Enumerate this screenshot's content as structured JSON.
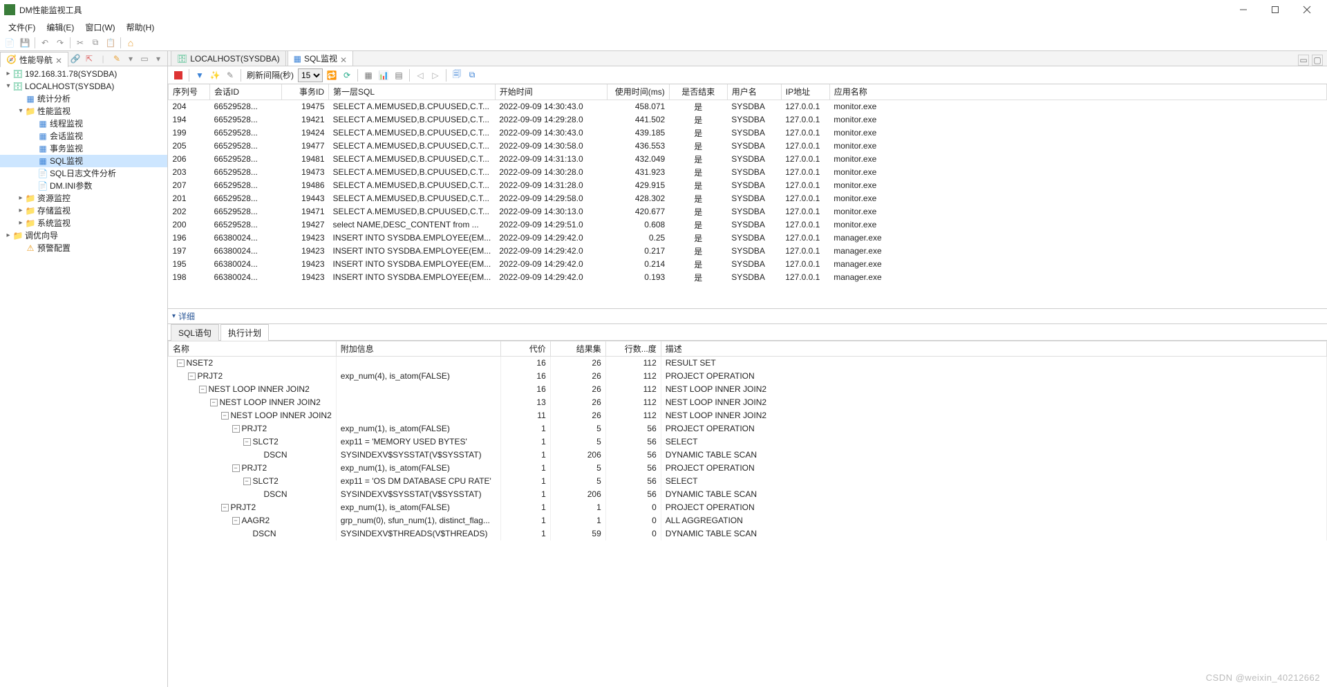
{
  "app": {
    "title": "DM性能监视工具"
  },
  "menu": {
    "file": "文件(F)",
    "edit": "编辑(E)",
    "window": "窗口(W)",
    "help": "帮助(H)"
  },
  "sidebar": {
    "tab_label": "性能导航",
    "tree": [
      {
        "indent": 0,
        "twisty": ">",
        "icon": "db",
        "label": "192.168.31.78(SYSDBA)"
      },
      {
        "indent": 0,
        "twisty": "v",
        "icon": "db",
        "label": "LOCALHOST(SYSDBA)"
      },
      {
        "indent": 1,
        "twisty": "",
        "icon": "grid",
        "label": "统计分析"
      },
      {
        "indent": 1,
        "twisty": "v",
        "icon": "folder",
        "label": "性能监视"
      },
      {
        "indent": 2,
        "twisty": "",
        "icon": "grid",
        "label": "线程监视"
      },
      {
        "indent": 2,
        "twisty": "",
        "icon": "grid",
        "label": "会话监视"
      },
      {
        "indent": 2,
        "twisty": "",
        "icon": "grid",
        "label": "事务监视"
      },
      {
        "indent": 2,
        "twisty": "",
        "icon": "sql",
        "label": "SQL监视",
        "selected": true
      },
      {
        "indent": 2,
        "twisty": "",
        "icon": "log",
        "label": "SQL日志文件分析"
      },
      {
        "indent": 2,
        "twisty": "",
        "icon": "ini",
        "label": "DM.INI参数"
      },
      {
        "indent": 1,
        "twisty": ">",
        "icon": "folder",
        "label": "资源监控"
      },
      {
        "indent": 1,
        "twisty": ">",
        "icon": "folder",
        "label": "存储监视"
      },
      {
        "indent": 1,
        "twisty": ">",
        "icon": "folder",
        "label": "系统监视"
      },
      {
        "indent": 0,
        "twisty": ">",
        "icon": "folder",
        "label": "调优向导"
      },
      {
        "indent": 1,
        "twisty": "",
        "icon": "alert",
        "label": "预警配置"
      }
    ]
  },
  "tabs": {
    "host": "LOCALHOST(SYSDBA)",
    "sql": "SQL监视"
  },
  "toolbar": {
    "refresh_label": "刷新间隔(秒)",
    "refresh_value": "15"
  },
  "grid": {
    "columns": [
      "序列号",
      "会话ID",
      "事务ID",
      "第一层SQL",
      "开始时间",
      "使用时间(ms)",
      "是否结束",
      "用户名",
      "IP地址",
      "应用名称"
    ],
    "rows": [
      [
        "204",
        "66529528...",
        "19475",
        "SELECT A.MEMUSED,B.CPUUSED,C.T...",
        "2022-09-09 14:30:43.0",
        "458.071",
        "是",
        "SYSDBA",
        "127.0.0.1",
        "monitor.exe"
      ],
      [
        "194",
        "66529528...",
        "19421",
        "SELECT A.MEMUSED,B.CPUUSED,C.T...",
        "2022-09-09 14:29:28.0",
        "441.502",
        "是",
        "SYSDBA",
        "127.0.0.1",
        "monitor.exe"
      ],
      [
        "199",
        "66529528...",
        "19424",
        "SELECT A.MEMUSED,B.CPUUSED,C.T...",
        "2022-09-09 14:30:43.0",
        "439.185",
        "是",
        "SYSDBA",
        "127.0.0.1",
        "monitor.exe"
      ],
      [
        "205",
        "66529528...",
        "19477",
        "SELECT A.MEMUSED,B.CPUUSED,C.T...",
        "2022-09-09 14:30:58.0",
        "436.553",
        "是",
        "SYSDBA",
        "127.0.0.1",
        "monitor.exe"
      ],
      [
        "206",
        "66529528...",
        "19481",
        "SELECT A.MEMUSED,B.CPUUSED,C.T...",
        "2022-09-09 14:31:13.0",
        "432.049",
        "是",
        "SYSDBA",
        "127.0.0.1",
        "monitor.exe"
      ],
      [
        "203",
        "66529528...",
        "19473",
        "SELECT A.MEMUSED,B.CPUUSED,C.T...",
        "2022-09-09 14:30:28.0",
        "431.923",
        "是",
        "SYSDBA",
        "127.0.0.1",
        "monitor.exe"
      ],
      [
        "207",
        "66529528...",
        "19486",
        "SELECT A.MEMUSED,B.CPUUSED,C.T...",
        "2022-09-09 14:31:28.0",
        "429.915",
        "是",
        "SYSDBA",
        "127.0.0.1",
        "monitor.exe"
      ],
      [
        "201",
        "66529528...",
        "19443",
        "SELECT A.MEMUSED,B.CPUUSED,C.T...",
        "2022-09-09 14:29:58.0",
        "428.302",
        "是",
        "SYSDBA",
        "127.0.0.1",
        "monitor.exe"
      ],
      [
        "202",
        "66529528...",
        "19471",
        "SELECT A.MEMUSED,B.CPUUSED,C.T...",
        "2022-09-09 14:30:13.0",
        "420.677",
        "是",
        "SYSDBA",
        "127.0.0.1",
        "monitor.exe"
      ],
      [
        "200",
        "66529528...",
        "19427",
        "select NAME,DESC_CONTENT from ...",
        "2022-09-09 14:29:51.0",
        "0.608",
        "是",
        "SYSDBA",
        "127.0.0.1",
        "monitor.exe"
      ],
      [
        "196",
        "66380024...",
        "19423",
        "INSERT INTO SYSDBA.EMPLOYEE(EM...",
        "2022-09-09 14:29:42.0",
        "0.25",
        "是",
        "SYSDBA",
        "127.0.0.1",
        "manager.exe"
      ],
      [
        "197",
        "66380024...",
        "19423",
        "INSERT INTO SYSDBA.EMPLOYEE(EM...",
        "2022-09-09 14:29:42.0",
        "0.217",
        "是",
        "SYSDBA",
        "127.0.0.1",
        "manager.exe"
      ],
      [
        "195",
        "66380024...",
        "19423",
        "INSERT INTO SYSDBA.EMPLOYEE(EM...",
        "2022-09-09 14:29:42.0",
        "0.214",
        "是",
        "SYSDBA",
        "127.0.0.1",
        "manager.exe"
      ],
      [
        "198",
        "66380024...",
        "19423",
        "INSERT INTO SYSDBA.EMPLOYEE(EM...",
        "2022-09-09 14:29:42.0",
        "0.193",
        "是",
        "SYSDBA",
        "127.0.0.1",
        "manager.exe"
      ]
    ]
  },
  "details": {
    "header": "详细",
    "tab_sql": "SQL语句",
    "tab_plan": "执行计划"
  },
  "plan": {
    "columns": [
      "名称",
      "附加信息",
      "代价",
      "结果集",
      "行数...度",
      "描述"
    ],
    "rows": [
      {
        "indent": 0,
        "tw": "-",
        "name": "NSET2",
        "extra": "",
        "cost": "16",
        "rs": "26",
        "rows": "112",
        "desc": "RESULT SET"
      },
      {
        "indent": 1,
        "tw": "-",
        "name": "PRJT2",
        "extra": "exp_num(4), is_atom(FALSE)",
        "cost": "16",
        "rs": "26",
        "rows": "112",
        "desc": "PROJECT OPERATION"
      },
      {
        "indent": 2,
        "tw": "-",
        "name": "NEST LOOP INNER JOIN2",
        "extra": "",
        "cost": "16",
        "rs": "26",
        "rows": "112",
        "desc": "NEST LOOP INNER JOIN2"
      },
      {
        "indent": 3,
        "tw": "-",
        "name": "NEST LOOP INNER JOIN2",
        "extra": "",
        "cost": "13",
        "rs": "26",
        "rows": "112",
        "desc": "NEST LOOP INNER JOIN2"
      },
      {
        "indent": 4,
        "tw": "-",
        "name": "NEST LOOP INNER JOIN2",
        "extra": "",
        "cost": "11",
        "rs": "26",
        "rows": "112",
        "desc": "NEST LOOP INNER JOIN2"
      },
      {
        "indent": 5,
        "tw": "-",
        "name": "PRJT2",
        "extra": "exp_num(1), is_atom(FALSE)",
        "cost": "1",
        "rs": "5",
        "rows": "56",
        "desc": "PROJECT OPERATION"
      },
      {
        "indent": 6,
        "tw": "-",
        "name": "SLCT2",
        "extra": "exp11 = 'MEMORY USED BYTES'",
        "cost": "1",
        "rs": "5",
        "rows": "56",
        "desc": "SELECT"
      },
      {
        "indent": 7,
        "tw": "",
        "name": "DSCN",
        "extra": "SYSINDEXV$SYSSTAT(V$SYSSTAT)",
        "cost": "1",
        "rs": "206",
        "rows": "56",
        "desc": "DYNAMIC TABLE SCAN"
      },
      {
        "indent": 5,
        "tw": "-",
        "name": "PRJT2",
        "extra": "exp_num(1), is_atom(FALSE)",
        "cost": "1",
        "rs": "5",
        "rows": "56",
        "desc": "PROJECT OPERATION"
      },
      {
        "indent": 6,
        "tw": "-",
        "name": "SLCT2",
        "extra": "exp11 = 'OS DM DATABASE CPU RATE'",
        "cost": "1",
        "rs": "5",
        "rows": "56",
        "desc": "SELECT"
      },
      {
        "indent": 7,
        "tw": "",
        "name": "DSCN",
        "extra": "SYSINDEXV$SYSSTAT(V$SYSSTAT)",
        "cost": "1",
        "rs": "206",
        "rows": "56",
        "desc": "DYNAMIC TABLE SCAN"
      },
      {
        "indent": 4,
        "tw": "-",
        "name": "PRJT2",
        "extra": "exp_num(1), is_atom(FALSE)",
        "cost": "1",
        "rs": "1",
        "rows": "0",
        "desc": "PROJECT OPERATION"
      },
      {
        "indent": 5,
        "tw": "-",
        "name": "AAGR2",
        "extra": "grp_num(0), sfun_num(1), distinct_flag...",
        "cost": "1",
        "rs": "1",
        "rows": "0",
        "desc": "ALL AGGREGATION"
      },
      {
        "indent": 6,
        "tw": "",
        "name": "DSCN",
        "extra": "SYSINDEXV$THREADS(V$THREADS)",
        "cost": "1",
        "rs": "59",
        "rows": "0",
        "desc": "DYNAMIC TABLE SCAN"
      }
    ]
  },
  "watermark": "CSDN @weixin_40212662"
}
